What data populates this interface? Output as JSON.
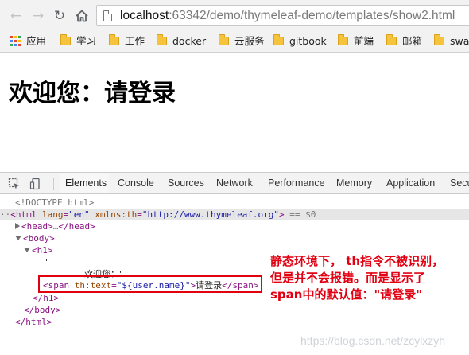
{
  "browser": {
    "url_host": "localhost",
    "url_path": ":63342/demo/thymeleaf-demo/templates/show2.html"
  },
  "bookmarks": [
    {
      "label": "应用",
      "icon": "apps-grid-icon"
    },
    {
      "label": "学习",
      "icon": "folder-icon"
    },
    {
      "label": "工作",
      "icon": "folder-icon"
    },
    {
      "label": "docker",
      "icon": "folder-icon"
    },
    {
      "label": "云服务",
      "icon": "folder-icon"
    },
    {
      "label": "gitbook",
      "icon": "folder-icon"
    },
    {
      "label": "前端",
      "icon": "folder-icon"
    },
    {
      "label": "邮箱",
      "icon": "folder-icon"
    },
    {
      "label": "swag",
      "icon": "folder-icon"
    }
  ],
  "page": {
    "heading_prefix": "欢迎您：",
    "heading_name": "请登录"
  },
  "devtools": {
    "tabs": [
      "Elements",
      "Console",
      "Sources",
      "Network",
      "Performance",
      "Memory",
      "Application",
      "Secu"
    ],
    "active_tab": "Elements",
    "tree": {
      "doctype": "<!DOCTYPE html>",
      "html_lang": "\"en\"",
      "html_xmlns": "\"http://www.thymeleaf.org\"",
      "dollar_zero": "== $0",
      "head_ellipsis": "…",
      "text_quote_open": "\"",
      "text_welcome": "欢迎您：\"",
      "span_attr_value": "\"${user.name}\"",
      "span_text": "请登录"
    }
  },
  "annotation": "静态环境下， th指令不被识别，但是并不会报错。而是显示了span中的默认值：\"请登录\"",
  "watermark": "https://blog.csdn.net/zcylxzyh",
  "colors": {
    "annotation_red": "#e20012",
    "tab_active_blue": "#1a73e8",
    "folder_yellow": "#f5c43c"
  }
}
